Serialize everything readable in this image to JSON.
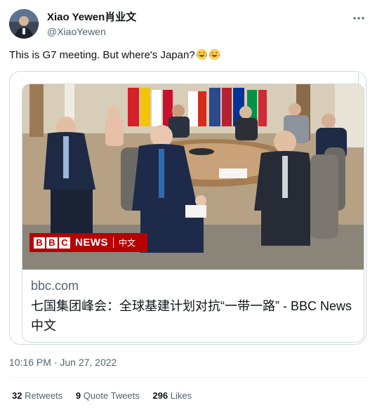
{
  "author": {
    "display_name": "Xiao Yewen肖业文",
    "handle": "@XiaoYewen",
    "more_icon": "more-icon"
  },
  "tweet": {
    "text": "This is G7 meeting. But where's Japan?",
    "emoji": [
      "face-with-tears-of-joy",
      "face-with-tears-of-joy"
    ]
  },
  "card": {
    "badge_brand": [
      "B",
      "B",
      "C"
    ],
    "badge_news": "NEWS",
    "badge_lang": "中文",
    "domain": "bbc.com",
    "title": "七国集团峰会：全球基建计划对抗“一带一路” - BBC News 中文"
  },
  "timestamp": "10:16 PM · Jun 27, 2022",
  "stats": {
    "retweets_count": "32",
    "retweets_label": "Retweets",
    "quotes_count": "9",
    "quotes_label": "Quote Tweets",
    "likes_count": "296",
    "likes_label": "Likes"
  },
  "colors": {
    "text_primary": "#0f1419",
    "text_secondary": "#536471",
    "border": "#cfd9de",
    "bbc_red": "#b80000"
  }
}
